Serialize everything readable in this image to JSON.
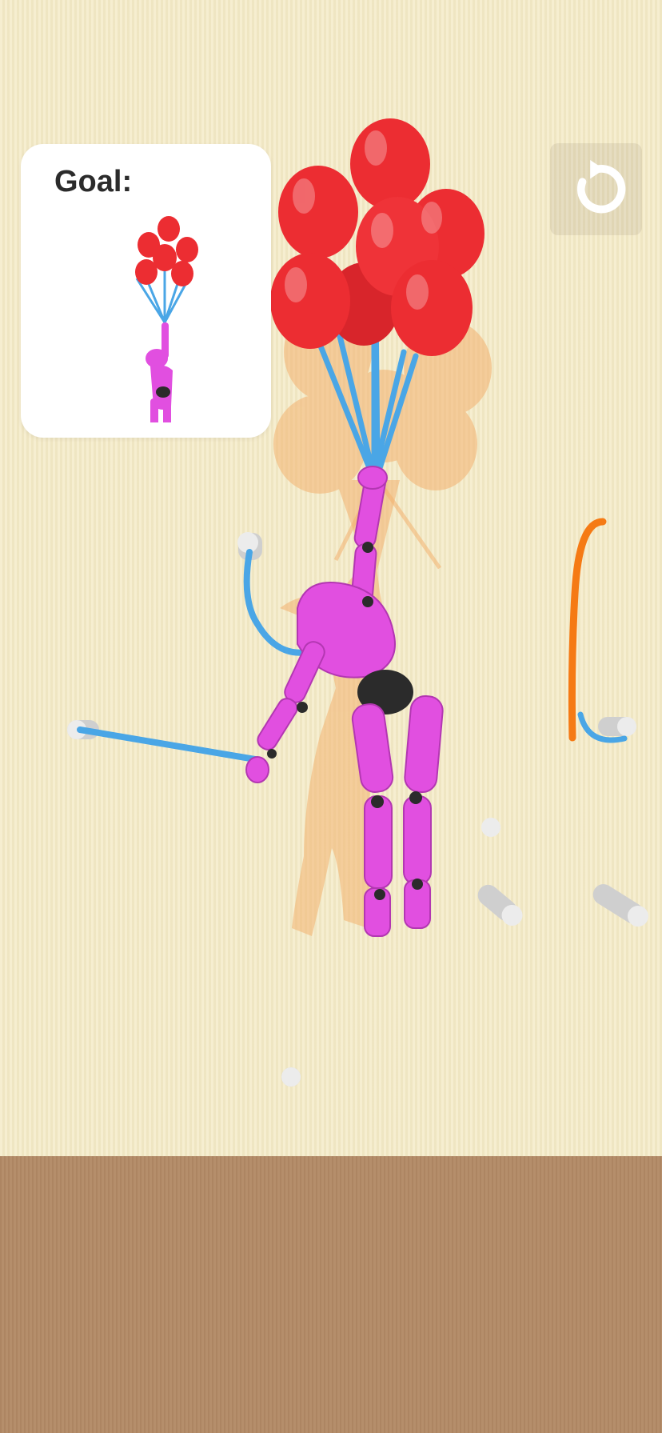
{
  "goal_card": {
    "label": "Goal:"
  },
  "reset_button": {
    "icon": "restart-arrow-icon"
  },
  "colors": {
    "wall": "#f4eac6",
    "floor": "#b38a66",
    "balloon": "#ec2d32",
    "rope": "#4aa6e6",
    "figure": "#e14fe0",
    "joint": "#2b2b2b",
    "hook": "#dcdcdc",
    "ghost": "#f3b26f",
    "orange_rope": "#f57a14"
  }
}
